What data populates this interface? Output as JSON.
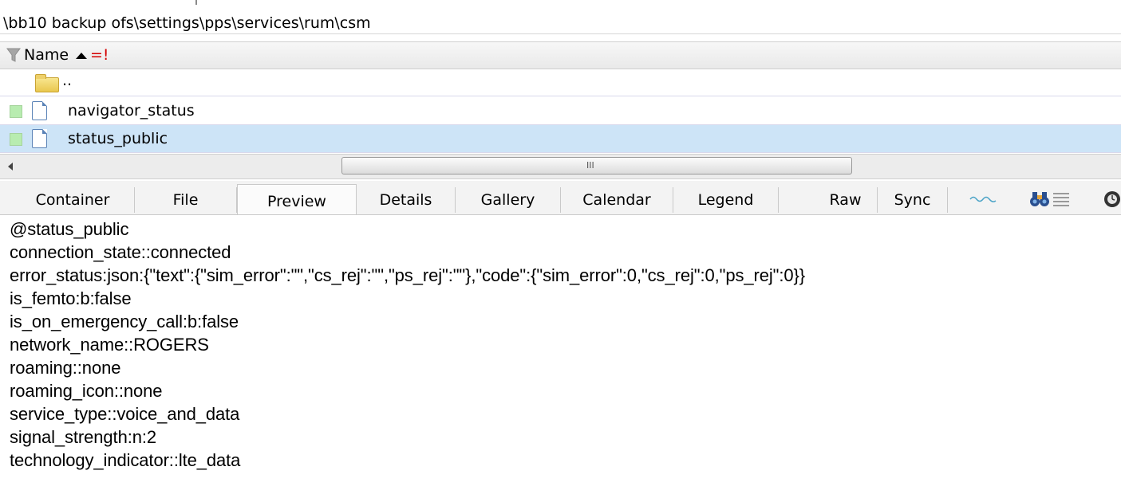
{
  "path": "\\bb10 backup ofs\\settings\\pps\\services\\rum\\csm",
  "column_header": {
    "name_label": "Name",
    "sort_flag": "=!"
  },
  "files": [
    {
      "label": "..",
      "type": "folder-up"
    },
    {
      "label": "navigator_status",
      "type": "file"
    },
    {
      "label": "status_public",
      "type": "file",
      "selected": true
    }
  ],
  "scrollbar": {
    "grip": "III"
  },
  "tabs": [
    {
      "label": "Container"
    },
    {
      "label": "File"
    },
    {
      "label": "Preview",
      "active": true
    },
    {
      "label": "Details"
    },
    {
      "label": "Gallery"
    },
    {
      "label": "Calendar"
    },
    {
      "label": "Legend"
    },
    {
      "label": "Raw"
    },
    {
      "label": "Sync"
    }
  ],
  "toolbar_icons": [
    "waveform-icon",
    "binoculars-icon",
    "list-icon",
    "clock-icon"
  ],
  "preview_lines": [
    "@status_public",
    "connection_state::connected",
    "error_status:json:{\"text\":{\"sim_error\":\"\",\"cs_rej\":\"\",\"ps_rej\":\"\"},\"code\":{\"sim_error\":0,\"cs_rej\":0,\"ps_rej\":0}}",
    "is_femto:b:false",
    "is_on_emergency_call:b:false",
    "network_name::ROGERS",
    "roaming::none",
    "roaming_icon::none",
    "service_type::voice_and_data",
    "signal_strength:n:2",
    "technology_indicator::lte_data"
  ],
  "colors": {
    "selected_row": "#cde4f7",
    "sort_flag": "#d40000",
    "check_box": "#b8ecb0"
  }
}
